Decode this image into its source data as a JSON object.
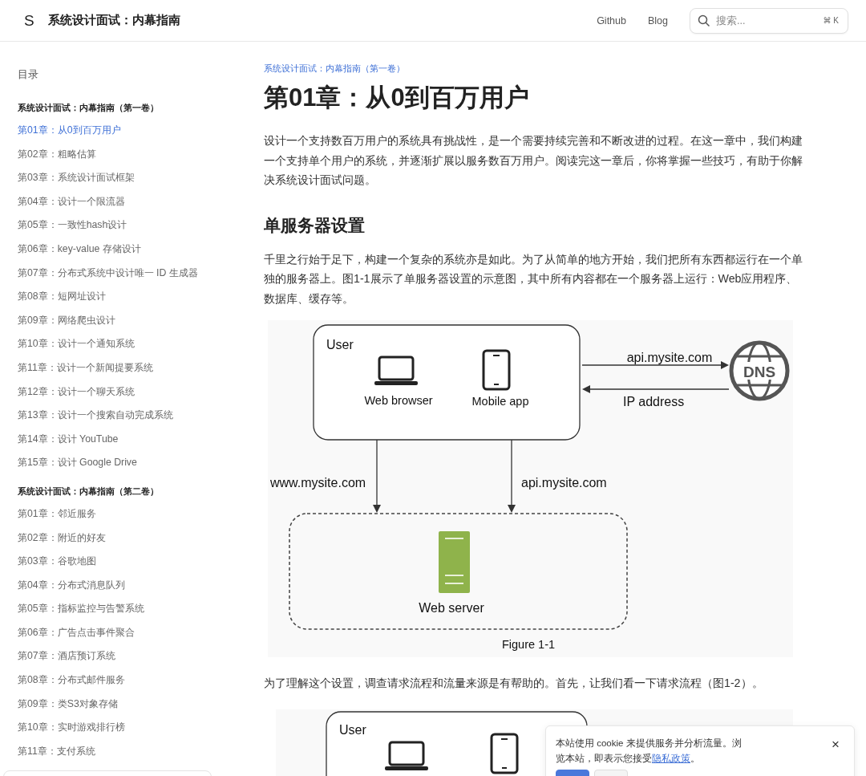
{
  "header": {
    "logo": "S",
    "title": "系统设计面试：内幕指南",
    "links": [
      "Github",
      "Blog"
    ],
    "search": {
      "placeholder": "搜索...",
      "shortcut": "⌘ K"
    }
  },
  "sidebar": {
    "title": "目录",
    "groups": [
      {
        "title": "系统设计面试：内幕指南（第一卷）",
        "items": [
          {
            "label": "第01章：从0到百万用户",
            "selected": true
          },
          {
            "label": "第02章：粗略估算",
            "selected": false
          },
          {
            "label": "第03章：系统设计面试框架",
            "selected": false
          },
          {
            "label": "第04章：设计一个限流器",
            "selected": false
          },
          {
            "label": "第05章：一致性hash设计",
            "selected": false
          },
          {
            "label": "第06章：key-value 存储设计",
            "selected": false
          },
          {
            "label": "第07章：分布式系统中设计唯一 ID 生成器",
            "selected": false
          },
          {
            "label": "第08章：短网址设计",
            "selected": false
          },
          {
            "label": "第09章：网络爬虫设计",
            "selected": false
          },
          {
            "label": "第10章：设计一个通知系统",
            "selected": false
          },
          {
            "label": "第11章：设计一个新闻提要系统",
            "selected": false
          },
          {
            "label": "第12章：设计一个聊天系统",
            "selected": false
          },
          {
            "label": "第13章：设计一个搜索自动完成系统",
            "selected": false
          },
          {
            "label": "第14章：设计 YouTube",
            "selected": false
          },
          {
            "label": "第15章：设计 Google Drive",
            "selected": false
          }
        ]
      },
      {
        "title": "系统设计面试：内幕指南（第二卷）",
        "items": [
          {
            "label": "第01章：邻近服务",
            "selected": false
          },
          {
            "label": "第02章：附近的好友",
            "selected": false
          },
          {
            "label": "第03章：谷歌地图",
            "selected": false
          },
          {
            "label": "第04章：分布式消息队列",
            "selected": false
          },
          {
            "label": "第05章：指标监控与告警系统",
            "selected": false
          },
          {
            "label": "第06章：广告点击事件聚合",
            "selected": false
          },
          {
            "label": "第07章：酒店预订系统",
            "selected": false
          },
          {
            "label": "第08章：分布式邮件服务",
            "selected": false
          },
          {
            "label": "第09章：类S3对象存储",
            "selected": false
          },
          {
            "label": "第10章：实时游戏排行榜",
            "selected": false
          },
          {
            "label": "第11章：支付系统",
            "selected": false
          }
        ]
      }
    ]
  },
  "article": {
    "breadcrumb": "系统设计面试：内幕指南（第一卷）",
    "title": "第01章：从0到百万用户",
    "intro": "设计一个支持数百万用户的系统具有挑战性，是一个需要持续完善和不断改进的过程。在这一章中，我们构建一个支持单个用户的系统，并逐渐扩展以服务数百万用户。阅读完这一章后，你将掌握一些技巧，有助于你解决系统设计面试问题。",
    "heading": "单服务器设置",
    "paragraph": "千里之行始于足下，构建一个复杂的系统亦是如此。为了从简单的地方开始，我们把所有东西都运行在一个单独的服务器上。图1-1展示了单服务器设置的示意图，其中所有内容都在一个服务器上运行：Web应用程序、数据库、缓存等。",
    "figure1": {
      "user": "User",
      "browser": "Web browser",
      "mobile": "Mobile app",
      "dns_request": "api.mysite.com",
      "dns_reply": "IP address",
      "dns": "DNS",
      "web_request": "www.mysite.com",
      "api_request": "api.mysite.com",
      "server": "Web server",
      "caption": "Figure 1-1"
    },
    "paragraph2": "为了理解这个设置，调查请求流程和流量来源是有帮助的。首先，让我们看一下请求流程（图1-2）。",
    "figure2": {
      "user": "User"
    }
  },
  "cookie": {
    "text": "本站使用 cookie 来提供服务并分析流量。浏览本站，即表示您接受",
    "link": "隐私政策",
    "end": "。",
    "close": "×"
  }
}
